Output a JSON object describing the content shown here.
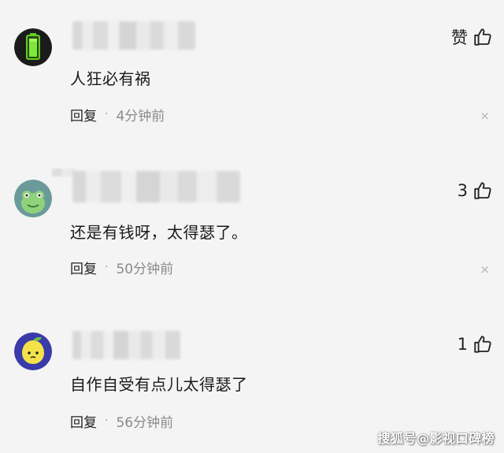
{
  "comments": [
    {
      "likes_label": "赞",
      "text": "人狂必有祸",
      "reply_label": "回复",
      "separator": "·",
      "time": "4分钟前",
      "close_symbol": "×"
    },
    {
      "likes_label": "3",
      "text": "还是有钱呀，太得瑟了。",
      "reply_label": "回复",
      "separator": "·",
      "time": "50分钟前",
      "close_symbol": "×"
    },
    {
      "likes_label": "1",
      "text": "自作自受有点儿太得瑟了",
      "reply_label": "回复",
      "separator": "·",
      "time": "56分钟前",
      "close_symbol": "×"
    }
  ],
  "watermark": "搜狐号@影视口碑榜",
  "colors": {
    "background": "#f4f4f4",
    "text": "#1a1a1a",
    "meta": "#8a8a8a",
    "avatar_1": "#1b1b1b",
    "avatar_2": "#6a9b9a",
    "avatar_3": "#3a3aa8"
  },
  "icons": {
    "like": "thumbs-up-icon",
    "close": "close-icon"
  }
}
